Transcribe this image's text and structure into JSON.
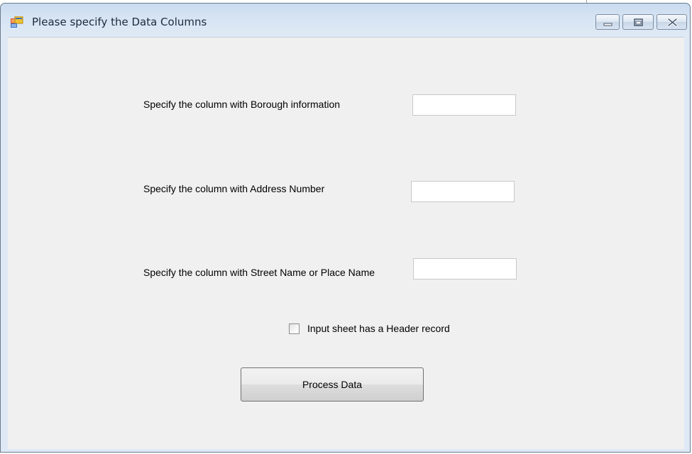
{
  "window": {
    "title": "Please specify the Data Columns",
    "icon": "app-form-icon",
    "controls": [
      "minimize-icon",
      "maximize-icon",
      "close-icon"
    ]
  },
  "form": {
    "borough_label": "Specify the column with Borough information",
    "borough_value": "",
    "address_label": "Specify the column with Address Number",
    "address_value": "",
    "street_label": "Specify the column with Street Name or Place Name",
    "street_value": "",
    "header_checkbox_label": "Input sheet has a Header record",
    "header_checked": false,
    "process_button_label": "Process Data"
  },
  "colors": {
    "client_background": "#f0f0f0",
    "title_bar": "#d6e4f3"
  }
}
